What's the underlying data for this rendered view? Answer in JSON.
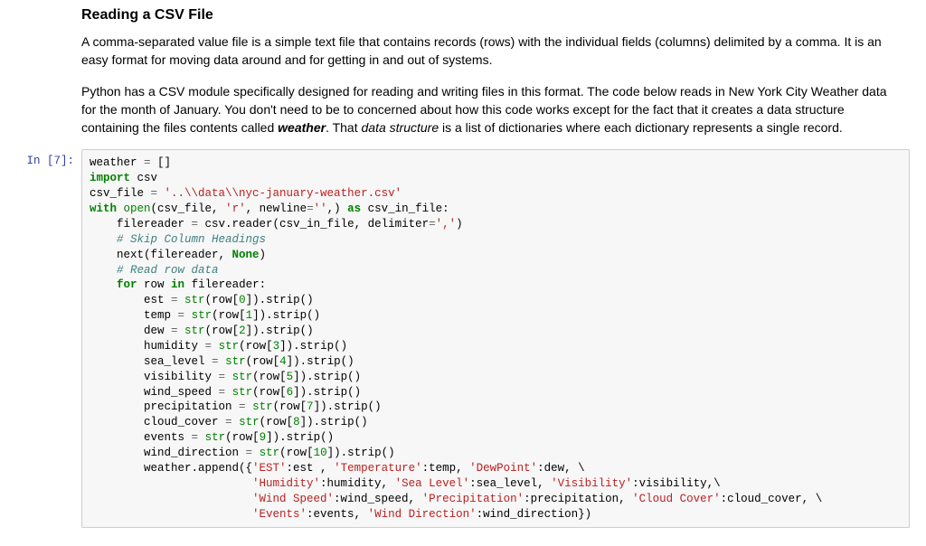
{
  "heading": "Reading a CSV File",
  "para1": "A comma-separated value file is a simple text file that contains records (rows) with the individual fields (columns) delimited by a comma. It is an easy format for moving data around and for getting in and out of systems.",
  "para2_a": "Python has a CSV module specifically designed for reading and writing files in this format. The code below reads in New York City Weather data for the month of January. You don't need to be to concerned about how this code works except for the fact that it creates a data structure containing the files contents called ",
  "para2_weather": "weather",
  "para2_b": ". That ",
  "para2_ds": "data structure",
  "para2_c": " is a list of dictionaries where each dictionary represents a single record.",
  "prompt": "In [7]:",
  "code": {
    "l01_a": "weather ",
    "l01_eq": "=",
    "l01_b": " []",
    "l02_kw": "import",
    "l02_b": " csv",
    "l03_a": "csv_file ",
    "l03_eq": "=",
    "l03_str": " '..\\\\data\\\\nyc-january-weather.csv'",
    "l04_with": "with",
    "l04_sp1": " ",
    "l04_open": "open",
    "l04_p1": "(csv_file, ",
    "l04_r": "'r'",
    "l04_c2": ", newline",
    "l04_eq": "=",
    "l04_empty": "''",
    "l04_c3": ",) ",
    "l04_as": "as",
    "l04_c4": " csv_in_file:",
    "l05_a": "    filereader ",
    "l05_eq": "=",
    "l05_b": " csv.reader(csv_in_file, delimiter",
    "l05_eq2": "=",
    "l05_comma": "','",
    "l05_end": ")",
    "l06": "    # Skip Column Headings",
    "l07_a": "    next(filereader, ",
    "l07_none": "None",
    "l07_b": ")",
    "l08": "    # Read row data",
    "l09_ind": "    ",
    "l09_for": "for",
    "l09_a": " row ",
    "l09_in": "in",
    "l09_b": " filereader:",
    "l10_a": "        est ",
    "l10_eq": "=",
    "l10_sp": " ",
    "l10_str": "str",
    "l10_b": "(row[",
    "l10_n": "0",
    "l10_c": "]).strip()",
    "l11_a": "        temp ",
    "l11_eq": "=",
    "l11_sp": " ",
    "l11_str": "str",
    "l11_b": "(row[",
    "l11_n": "1",
    "l11_c": "]).strip()",
    "l12_a": "        dew ",
    "l12_eq": "=",
    "l12_sp": " ",
    "l12_str": "str",
    "l12_b": "(row[",
    "l12_n": "2",
    "l12_c": "]).strip()",
    "l13_a": "        humidity ",
    "l13_eq": "=",
    "l13_sp": " ",
    "l13_str": "str",
    "l13_b": "(row[",
    "l13_n": "3",
    "l13_c": "]).strip()",
    "l14_a": "        sea_level ",
    "l14_eq": "=",
    "l14_sp": " ",
    "l14_str": "str",
    "l14_b": "(row[",
    "l14_n": "4",
    "l14_c": "]).strip()",
    "l15_a": "        visibility ",
    "l15_eq": "=",
    "l15_sp": " ",
    "l15_str": "str",
    "l15_b": "(row[",
    "l15_n": "5",
    "l15_c": "]).strip()",
    "l16_a": "        wind_speed ",
    "l16_eq": "=",
    "l16_sp": " ",
    "l16_str": "str",
    "l16_b": "(row[",
    "l16_n": "6",
    "l16_c": "]).strip()",
    "l17_a": "        precipitation ",
    "l17_eq": "=",
    "l17_sp": " ",
    "l17_str": "str",
    "l17_b": "(row[",
    "l17_n": "7",
    "l17_c": "]).strip()",
    "l18_a": "        cloud_cover ",
    "l18_eq": "=",
    "l18_sp": " ",
    "l18_str": "str",
    "l18_b": "(row[",
    "l18_n": "8",
    "l18_c": "]).strip()",
    "l19_a": "        events ",
    "l19_eq": "=",
    "l19_sp": " ",
    "l19_str": "str",
    "l19_b": "(row[",
    "l19_n": "9",
    "l19_c": "]).strip()",
    "l20_a": "        wind_direction ",
    "l20_eq": "=",
    "l20_sp": " ",
    "l20_str": "str",
    "l20_b": "(row[",
    "l20_n": "10",
    "l20_c": "]).strip()",
    "l21_a": "        weather.append({",
    "l21_s1": "'EST'",
    "l21_b": ":est , ",
    "l21_s2": "'Temperature'",
    "l21_c": ":temp, ",
    "l21_s3": "'DewPoint'",
    "l21_d": ":dew, \\",
    "l22_a": "                        ",
    "l22_s1": "'Humidity'",
    "l22_b": ":humidity, ",
    "l22_s2": "'Sea Level'",
    "l22_c": ":sea_level, ",
    "l22_s3": "'Visibility'",
    "l22_d": ":visibility,\\",
    "l23_a": "                        ",
    "l23_s1": "'Wind Speed'",
    "l23_b": ":wind_speed, ",
    "l23_s2": "'Precipitation'",
    "l23_c": ":precipitation, ",
    "l23_s3": "'Cloud Cover'",
    "l23_d": ":cloud_cover, \\",
    "l24_a": "                        ",
    "l24_s1": "'Events'",
    "l24_b": ":events, ",
    "l24_s2": "'Wind Direction'",
    "l24_c": ":wind_direction})"
  }
}
